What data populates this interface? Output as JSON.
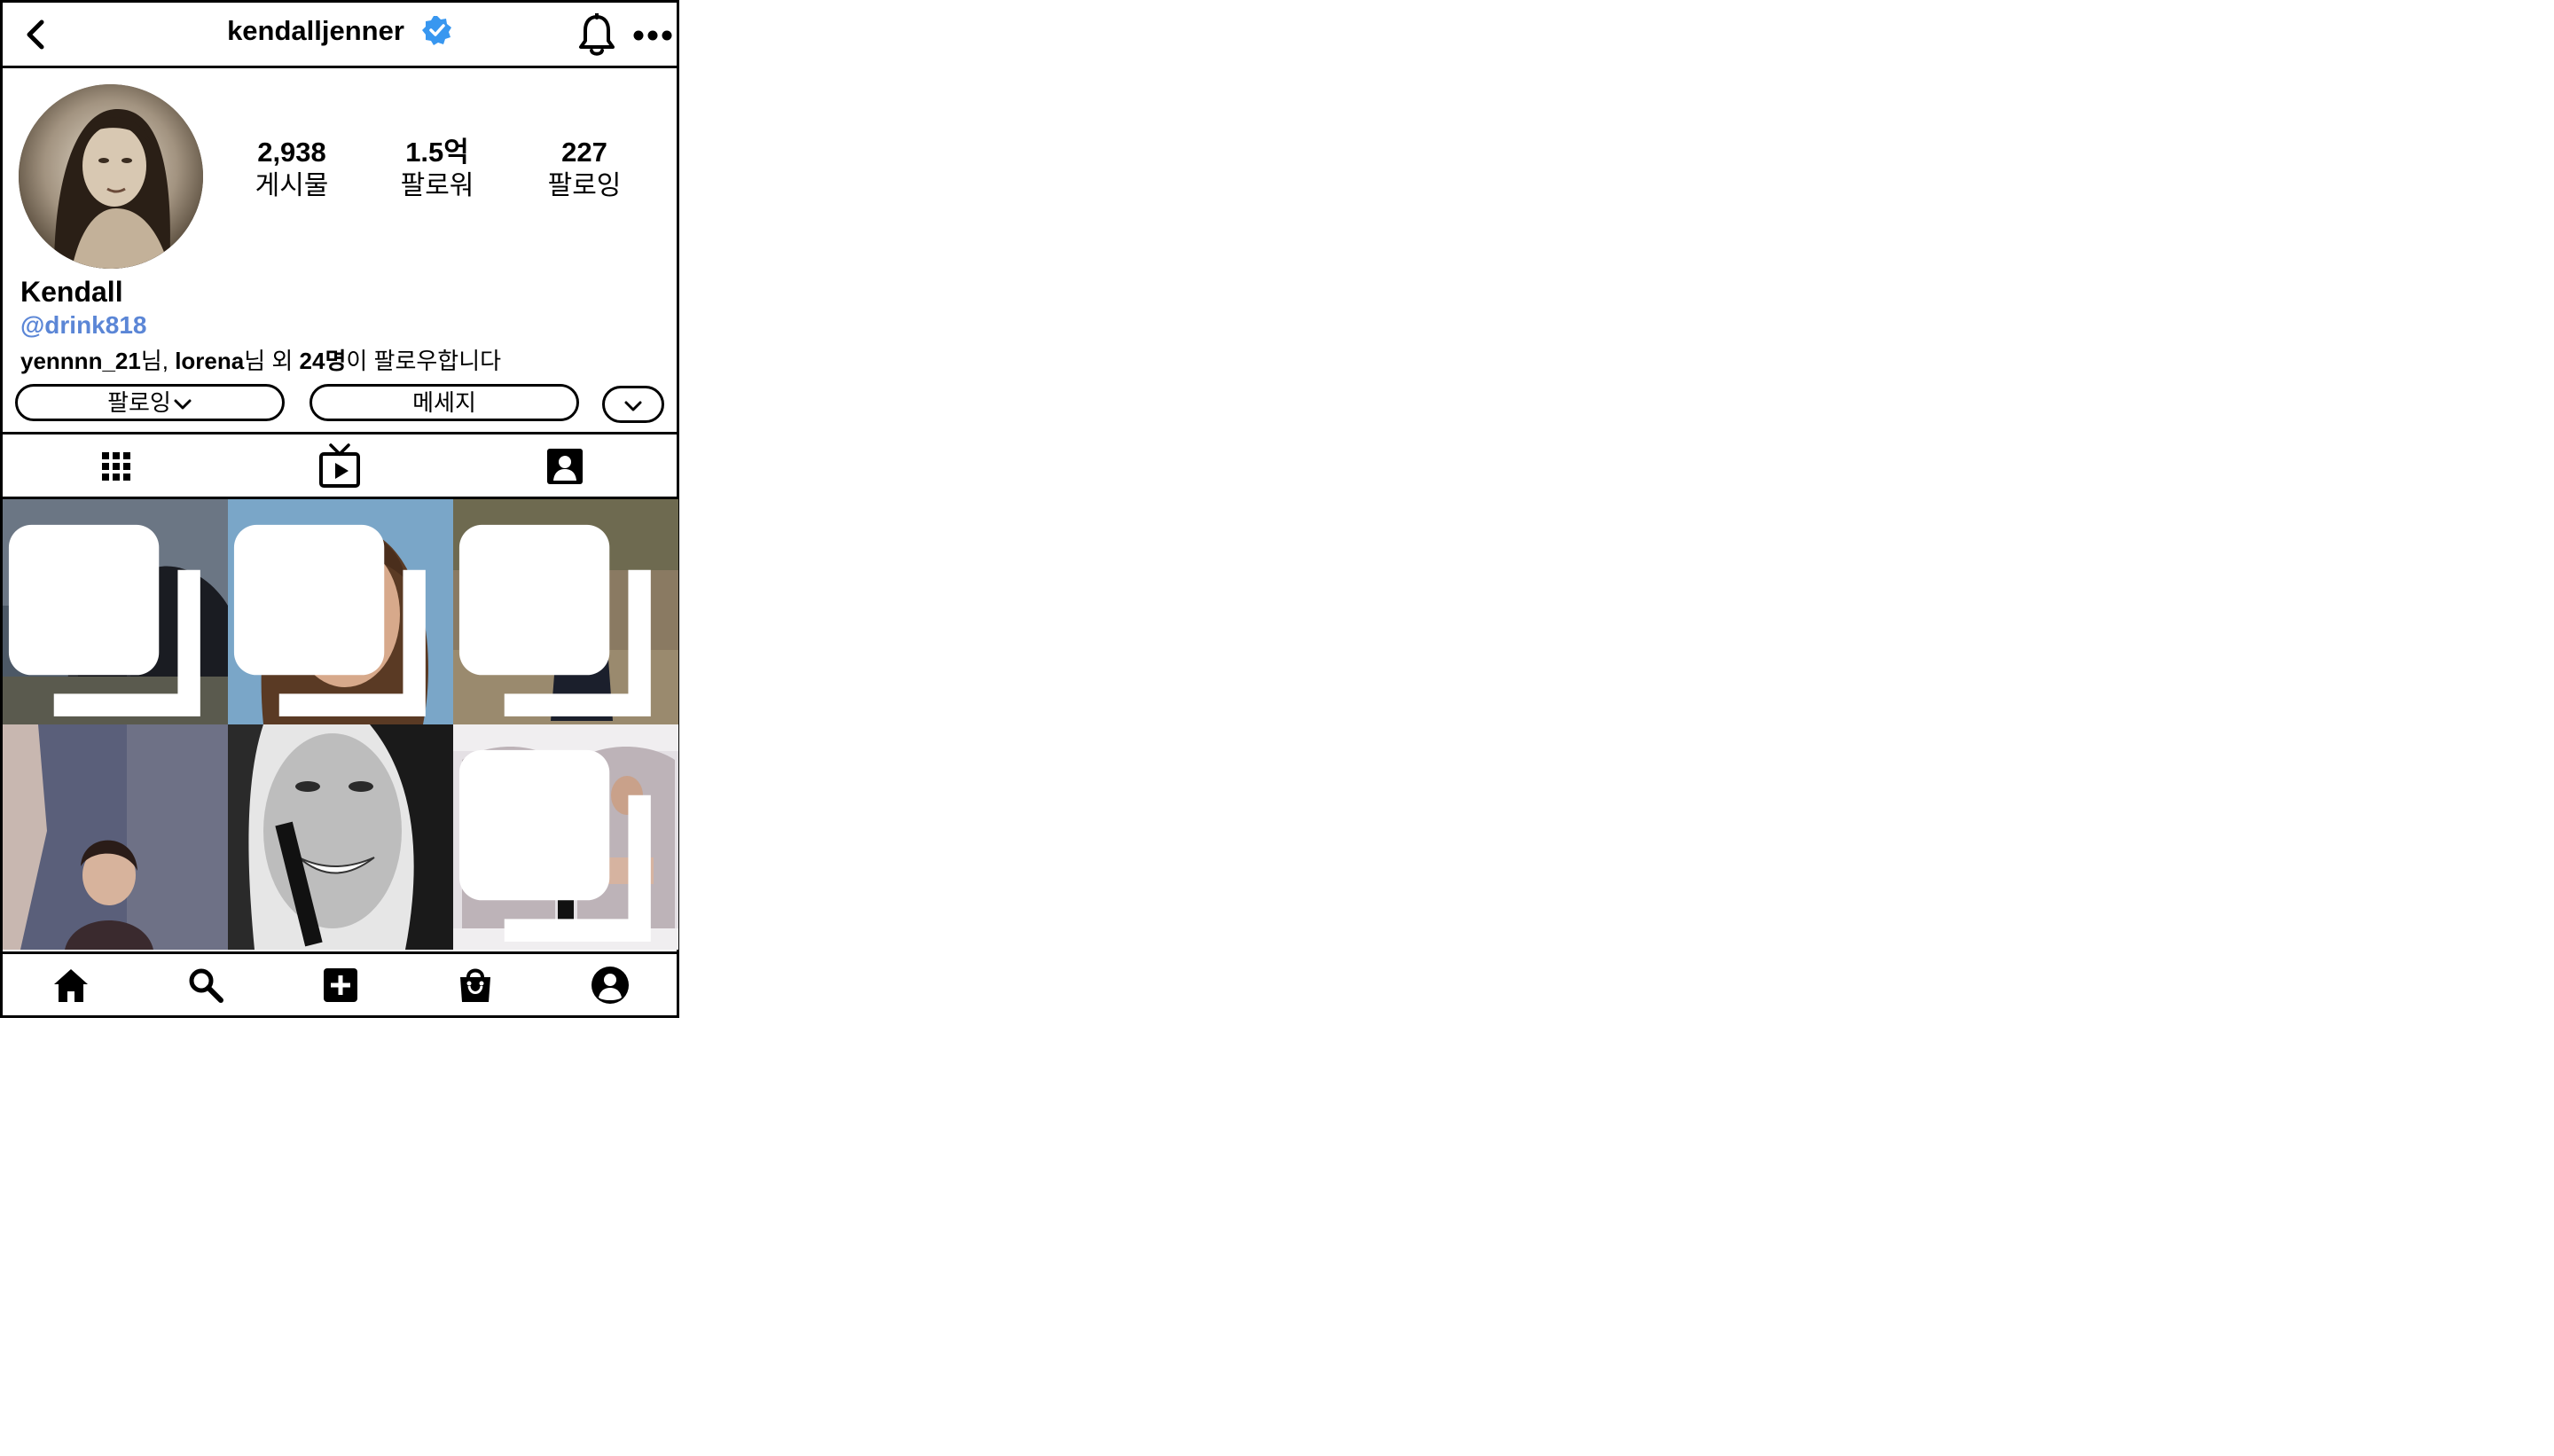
{
  "header": {
    "username": "kendalljenner",
    "verified": true,
    "back_icon": "chevron-left-icon",
    "bell_icon": "bell-icon",
    "more_icon": "more-horizontal-icon"
  },
  "profile": {
    "stats": [
      {
        "value": "2,938",
        "label": "게시물"
      },
      {
        "value": "1.5억",
        "label": "팔로워"
      },
      {
        "value": "227",
        "label": "팔로잉"
      }
    ],
    "display_name": "Kendall",
    "handle_link": "@drink818",
    "followed_by": {
      "user1": "yennnn_21",
      "sep1": "님, ",
      "user2": "lorena",
      "sep2": "님 외 ",
      "count": "24명",
      "tail": "이 팔로우합니다"
    },
    "buttons": {
      "following_label": "팔로잉",
      "message_label": "메세지"
    }
  },
  "tabs": [
    "posts-grid-icon",
    "igtv-icon",
    "tagged-icon"
  ],
  "posts": [
    {
      "id": 1,
      "multi": true,
      "accent": "#3b4a5c"
    },
    {
      "id": 2,
      "multi": true,
      "accent": "#7aa6c8"
    },
    {
      "id": 3,
      "multi": true,
      "accent": "#8a7a62"
    },
    {
      "id": 4,
      "multi": false,
      "accent": "#5a5f7a"
    },
    {
      "id": 5,
      "multi": false,
      "accent": "#888888"
    },
    {
      "id": 6,
      "multi": true,
      "accent": "#bdb3b8"
    }
  ],
  "bottom_nav": [
    "home-icon",
    "search-icon",
    "add-post-icon",
    "shop-icon",
    "profile-icon"
  ],
  "colors": {
    "verified_blue": "#3897f0",
    "link_blue": "#5b86d6",
    "border": "#000000"
  }
}
